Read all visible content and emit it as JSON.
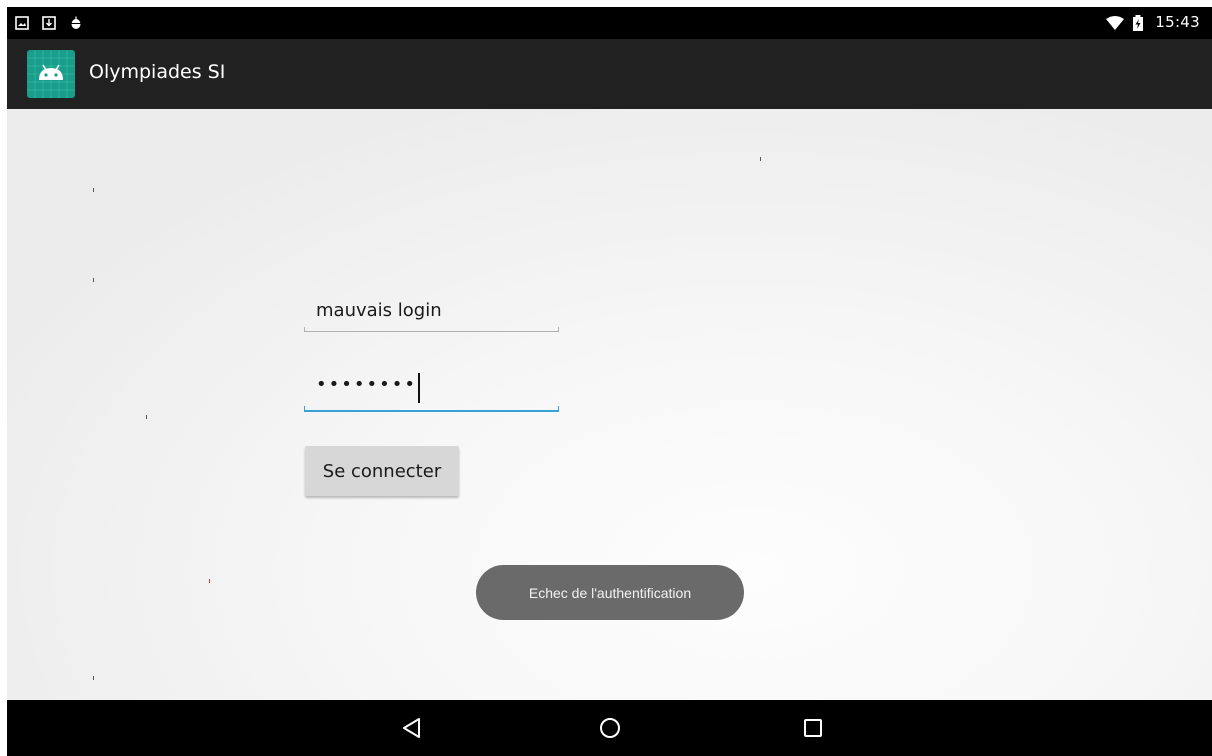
{
  "status_bar": {
    "time": "15:43",
    "left_icons": [
      "gallery-icon",
      "download-icon",
      "android-debug-icon"
    ],
    "right_icons": [
      "wifi-icon",
      "battery-charging-icon"
    ]
  },
  "action_bar": {
    "title": "Olympiades SI",
    "icon": "android-app-icon"
  },
  "form": {
    "login_value": "mauvais login",
    "password_value": "••••••••",
    "connect_label": "Se connecter"
  },
  "toast": {
    "message": "Echec de l'authentification"
  },
  "nav_bar": {
    "buttons": [
      "back-icon",
      "home-icon",
      "recents-icon"
    ]
  },
  "colors": {
    "accent": "#35a3d6",
    "app_icon_bg": "#1a9e8c",
    "action_bar": "#212121"
  }
}
